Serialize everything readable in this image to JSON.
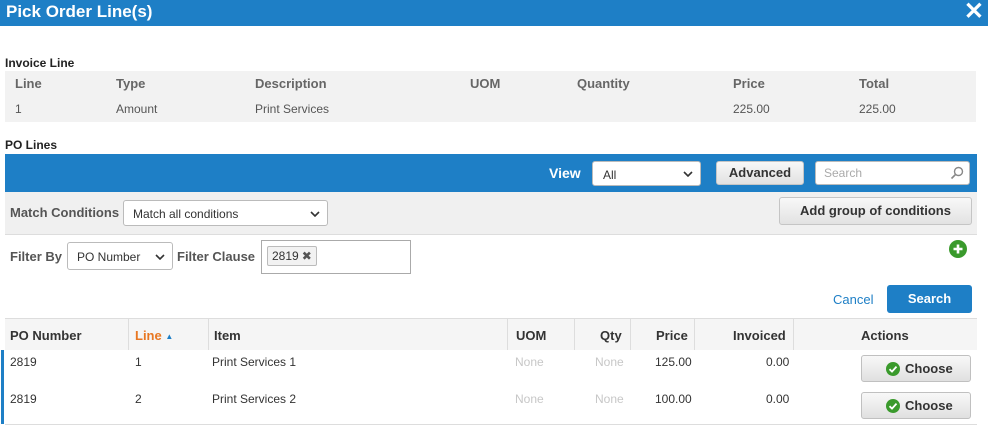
{
  "dialog": {
    "title": "Pick Order Line(s)",
    "close_icon": "close-icon"
  },
  "invoice_line": {
    "section_label": "Invoice Line",
    "headers": [
      "Line",
      "Type",
      "Description",
      "UOM",
      "Quantity",
      "Price",
      "Total"
    ],
    "row": [
      "1",
      "Amount",
      "Print Services",
      "",
      "",
      "225.00",
      "225.00"
    ]
  },
  "po_lines": {
    "section_label": "PO Lines",
    "toolbar": {
      "view_label": "View",
      "view_selected": "All",
      "advanced_label": "Advanced",
      "search_placeholder": "Search",
      "accent_color": "#1e7fc6"
    },
    "match": {
      "label": "Match Conditions",
      "selected": "Match all conditions",
      "add_group_label": "Add group of conditions"
    },
    "filter": {
      "filter_by_label": "Filter By",
      "filter_by_selected": "PO Number",
      "clause_label": "Filter Clause",
      "clause_tag": "2819",
      "cancel_label": "Cancel",
      "search_label": "Search"
    },
    "columns": [
      "PO Number",
      "Line",
      "Item",
      "UOM",
      "Qty",
      "Price",
      "Invoiced",
      "Actions"
    ],
    "sorted_column": "Line",
    "sort_direction": "ascending",
    "rows": [
      {
        "po_number": "2819",
        "line": "1",
        "item": "Print Services 1",
        "uom": "None",
        "qty": "None",
        "price": "125.00",
        "invoiced": "0.00",
        "action": "Choose"
      },
      {
        "po_number": "2819",
        "line": "2",
        "item": "Print Services 2",
        "uom": "None",
        "qty": "None",
        "price": "100.00",
        "invoiced": "0.00",
        "action": "Choose"
      }
    ]
  }
}
